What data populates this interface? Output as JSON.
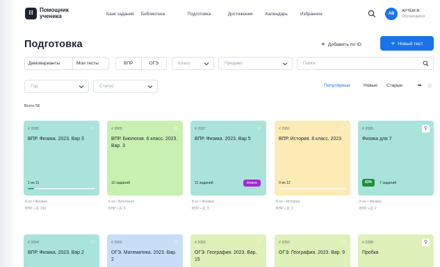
{
  "brand": {
    "name": "Помощник ученика"
  },
  "nav": {
    "items": [
      "Банк заданий",
      "Библиотека",
      "Подготовка",
      "Достижения",
      "Календарь",
      "Избранное"
    ]
  },
  "user": {
    "initials": "АВ",
    "name": "АРТЁМ В.",
    "role": "Обучающийся"
  },
  "page": {
    "title": "Подготовка",
    "add_by_id": "Добавить по ID",
    "new_test": "Новый тест"
  },
  "filters": {
    "seg1": [
      "Демоварианты",
      "Мои тесты"
    ],
    "seg2": [
      "ВПР",
      "ОГЭ"
    ],
    "class_ph": "Класс",
    "subject_ph": "Предмет",
    "search_ph": "Поиск",
    "year_ph": "Год",
    "status_ph": "Статус"
  },
  "sort": {
    "popular": "Популярные",
    "new": "Новые",
    "old": "Старые"
  },
  "total": "Всего 58",
  "cards": [
    {
      "id": "# 2085",
      "title": "ВПР. Физика. 2023. Вар 3",
      "stat": "1 из 11",
      "progress": 0.09,
      "fill": "#2aa36b",
      "bg": "#a9e3da",
      "meta1": "8 кл  •  Физика",
      "meta2": "ВПР  •  Д: 150"
    },
    {
      "id": "# 2065",
      "title": "ВПР. Биология. 6 класс. 2023. Вар. 3",
      "stat": "10 заданий",
      "bg": "#c8f0b0",
      "meta1": "6 кл  •  Биология",
      "meta2": "ВПР  •  Д: 6"
    },
    {
      "id": "# 2087",
      "title": "ВПР. Физика. 2023. Вар 5",
      "stat": "11 заданий",
      "badge": "Новое",
      "bg": "#a9e3da",
      "meta1": "8 кл  •  Физика",
      "meta2": "ВПР  •  Д: 3"
    },
    {
      "id": "# 2062",
      "title": "ВПР. История. 8 класс. 2023",
      "stat": "0 из 12",
      "progress": 0,
      "fill": "#e0b84a",
      "bg": "#fdebb5",
      "meta1": "8 кл  •  История",
      "meta2": "ВПР  •  Д: 3"
    },
    {
      "id": "# 2095",
      "title": "Физика для 7",
      "pct": "83%",
      "stat": "7 заданий",
      "bg": "#a9e3da",
      "meta1": "8 кл  •  Физика",
      "meta2": "ВПР  •  Д: 2"
    },
    {
      "id": "# 2094",
      "title": "ВПР. Физика. 2023. Вар 2",
      "bg": "#a9e3da"
    },
    {
      "id": "# 2060",
      "title": "ОГЭ. Математика. 2023. Вар. 2",
      "bg": "#c9def6"
    },
    {
      "id": "# 2056",
      "title": "ОГЭ. География. 2023. Вар. 15",
      "bg": "#ddf1b8"
    },
    {
      "id": "# 2050",
      "title": "ОГЭ. География. 2023. Вар. 9",
      "bg": "#ddf1b8"
    },
    {
      "id": "# 2288",
      "title": "Пробка",
      "bg": "#ddf1b8"
    }
  ],
  "colors": {
    "accent": "#1a73e8",
    "badge_new": "#a228d6",
    "badge_pct": "#1e8f3a"
  }
}
